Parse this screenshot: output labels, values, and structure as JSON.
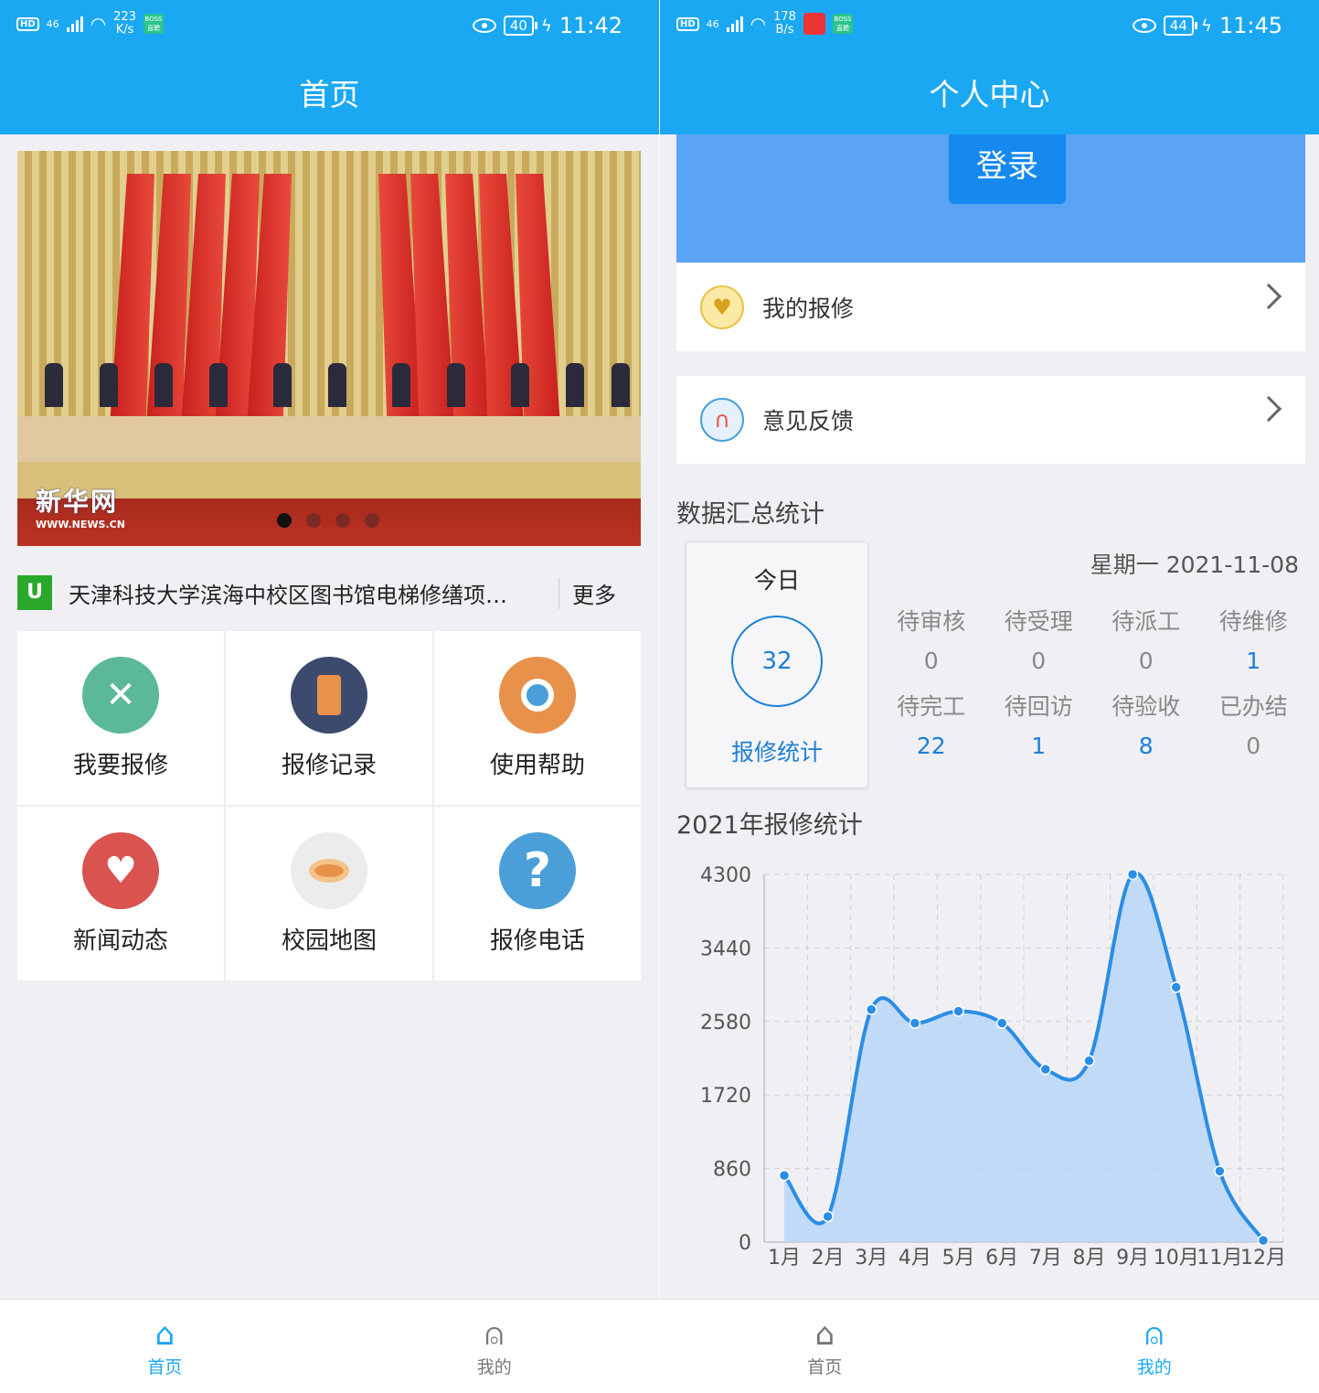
{
  "left": {
    "status": {
      "net_type": "46",
      "speed_value": "223",
      "speed_unit": "K/s",
      "battery": "40",
      "time": "11:42"
    },
    "title": "首页",
    "banner": {
      "logo_text": "新华网",
      "logo_sub": "WWW.NEWS.CN",
      "slide_count": 4,
      "active_slide": 1
    },
    "news": {
      "icon_text": "U",
      "headline": "天津科技大学滨海中校区图书馆电梯修缮项…",
      "more_label": "更多"
    },
    "grid": [
      {
        "label": "我要报修",
        "icon": "wrench-screwdriver-icon",
        "color": "#5cb89a"
      },
      {
        "label": "报修记录",
        "icon": "record-book-icon",
        "color": "#3c4a6e"
      },
      {
        "label": "使用帮助",
        "icon": "magnifier-icon",
        "color": "#e8914a"
      },
      {
        "label": "新闻动态",
        "icon": "heart-icon",
        "color": "#d9534f"
      },
      {
        "label": "校园地图",
        "icon": "eye-icon",
        "color": "#e6e6e6"
      },
      {
        "label": "报修电话",
        "icon": "question-mark-icon",
        "color": "#4a9fd8"
      }
    ],
    "tabs": [
      {
        "label": "首页"
      },
      {
        "label": "我的"
      }
    ]
  },
  "right": {
    "status": {
      "net_type": "46",
      "speed_value": "178",
      "speed_unit": "B/s",
      "battery": "44",
      "time": "11:45"
    },
    "title": "个人中心",
    "login_label": "登录",
    "menu": [
      {
        "label": "我的报修",
        "icon": "heart-badge-icon"
      },
      {
        "label": "意见反馈",
        "icon": "headphones-icon"
      }
    ],
    "summary_title": "数据汇总统计",
    "today": {
      "label": "今日",
      "count": "32",
      "caption": "报修统计"
    },
    "date": "星期一 2021-11-08",
    "stats": [
      {
        "label": "待审核",
        "value": "0"
      },
      {
        "label": "待受理",
        "value": "0"
      },
      {
        "label": "待派工",
        "value": "0"
      },
      {
        "label": "待维修",
        "value": "1"
      },
      {
        "label": "待完工",
        "value": "22"
      },
      {
        "label": "待回访",
        "value": "1"
      },
      {
        "label": "待验收",
        "value": "8"
      },
      {
        "label": "已办结",
        "value": "0"
      }
    ],
    "chart_title": "2021年报修统计",
    "tabs": [
      {
        "label": "首页"
      },
      {
        "label": "我的"
      }
    ],
    "colors": {
      "accent": "#1ba8f2",
      "line": "#2a8de6",
      "fill": "#b8d6f7"
    }
  },
  "chart_data": {
    "type": "area",
    "title": "2021年报修统计",
    "categories": [
      "1月",
      "2月",
      "3月",
      "4月",
      "5月",
      "6月",
      "7月",
      "8月",
      "9月",
      "10月",
      "11月",
      "12月"
    ],
    "values": [
      780,
      300,
      2720,
      2560,
      2700,
      2560,
      2020,
      2120,
      4300,
      2980,
      830,
      20
    ],
    "yticks": [
      0,
      860,
      1720,
      2580,
      3440,
      4300
    ],
    "ylim": [
      0,
      4300
    ],
    "grid": true
  }
}
